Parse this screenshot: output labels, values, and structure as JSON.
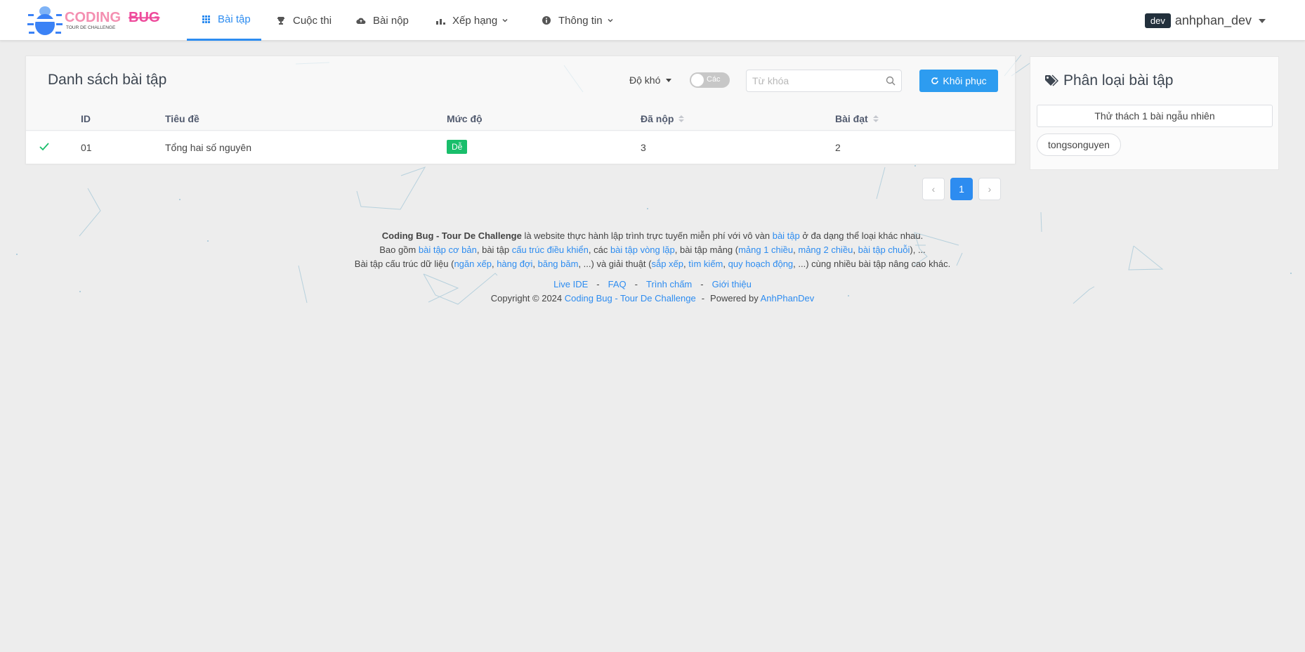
{
  "brand": {
    "name_part1": "CODING",
    "name_part2": "BUG",
    "tagline": "TOUR DE CHALLENGE"
  },
  "nav": {
    "items": [
      {
        "label": "Bài tập",
        "icon": "grid-icon"
      },
      {
        "label": "Cuộc thi",
        "icon": "trophy-icon"
      },
      {
        "label": "Bài nộp",
        "icon": "cloud-upload-icon"
      },
      {
        "label": "Xếp hạng",
        "icon": "bar-chart-icon"
      },
      {
        "label": "Thông tin",
        "icon": "info-icon"
      }
    ],
    "active": "Bài tập"
  },
  "user": {
    "badge": "dev",
    "name": "anhphan_dev"
  },
  "problems": {
    "title": "Danh sách bài tập",
    "difficulty_label": "Độ khó",
    "toggle_label": "Các",
    "search_placeholder": "Từ khóa",
    "search_value": "",
    "restore_label": "Khôi phục",
    "columns": {
      "id": "ID",
      "title": "Tiêu đề",
      "level": "Mức độ",
      "submitted": "Đã nộp",
      "accepted": "Bài đạt"
    },
    "rows": [
      {
        "solved": true,
        "id": "01",
        "title": "Tổng hai số nguyên",
        "level": "Dễ",
        "submitted": "3",
        "accepted": "2"
      }
    ]
  },
  "pagination": {
    "prev": "‹",
    "current": "1",
    "next": "›"
  },
  "sidebar": {
    "title": "Phân loại bài tập",
    "random_button": "Thử thách 1 bài ngẫu nhiên",
    "tags": [
      "tongsonguyen"
    ]
  },
  "footer": {
    "l1": {
      "bold": "Coding Bug - Tour De Challenge",
      "t1": " là website thực hành lập trình trực tuyến miễn phí với vô vàn ",
      "a1": "bài tập",
      "t2": " ở đa dạng thể loại khác nhau."
    },
    "l2": {
      "t0": "Bao gồm ",
      "a1": "bài tập cơ bản",
      "t1": ", bài tập ",
      "a2": "cấu trúc điều khiển",
      "t2": ", các ",
      "a3": "bài tập vòng lặp",
      "t3": ", bài tập mảng (",
      "a4": "mảng 1 chiều",
      "t4": ", ",
      "a5": "mảng 2 chiều",
      "t5": ", ",
      "a6": "bài tập chuỗi",
      "t6": "), ..."
    },
    "l3": {
      "t0": "Bài tập cấu trúc dữ liệu (",
      "a1": "ngăn xếp",
      "t1": ", ",
      "a2": "hàng đợi",
      "t2": ", ",
      "a3": "băng băm",
      "t3": ", ...) và giải thuật (",
      "a4": "sắp xếp",
      "t4": ", ",
      "a5": "tìm kiếm",
      "t5": ", ",
      "a6": "quy hoạch động",
      "t6": ", ...) cùng nhiều bài tập nâng cao khác."
    },
    "links": [
      "Live IDE",
      "FAQ",
      "Trình chấm",
      "Giới thiệu"
    ],
    "sep": "-",
    "copyright_prefix": "Copyright © 2024 ",
    "copyright_link": "Coding Bug - Tour De Challenge",
    "powered_prefix": "Powered by ",
    "powered_link": "AnhPhanDev"
  },
  "colors": {
    "primary": "#2d8cf0",
    "success": "#19be6b",
    "brand_pink": "#ee4a9b",
    "brand_blue": "#3b82f6"
  }
}
